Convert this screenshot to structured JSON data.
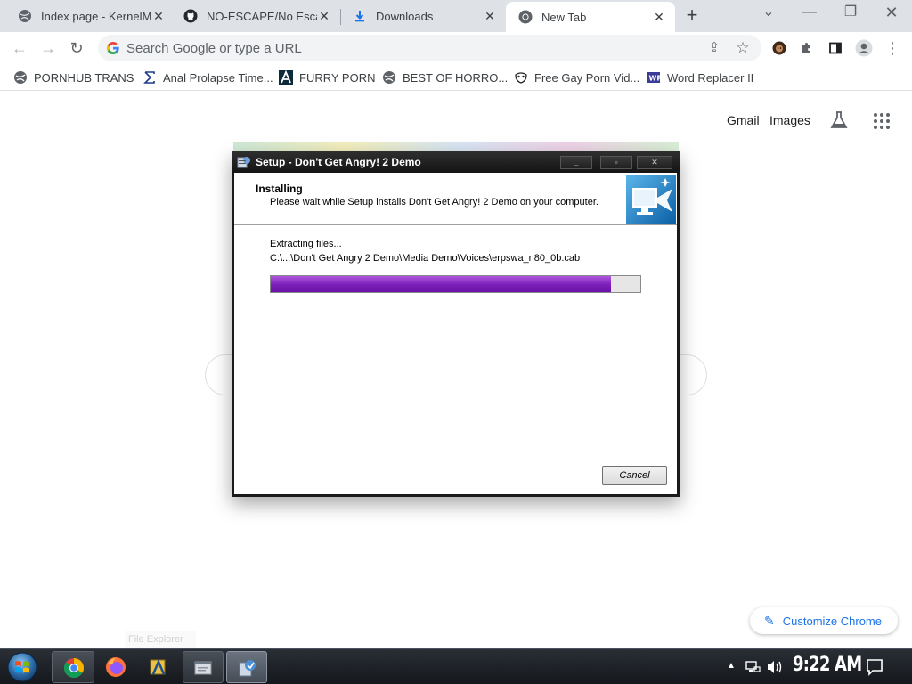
{
  "browser": {
    "tabs": [
      {
        "title": "Index page - KernelM",
        "favicon": "globe-icon",
        "active": false
      },
      {
        "title": "NO-ESCAPE/No Esca",
        "favicon": "github-icon",
        "active": false
      },
      {
        "title": "Downloads",
        "favicon": "download-icon",
        "active": false
      },
      {
        "title": "New Tab",
        "favicon": "chrome-icon",
        "active": true
      }
    ],
    "omnibox_placeholder": "Search Google or type a URL",
    "bookmarks": [
      {
        "label": "PORNHUB TRANS",
        "icon": "globe-icon"
      },
      {
        "label": "Anal Prolapse Time...",
        "icon": "sigma-icon"
      },
      {
        "label": "FURRY PORN",
        "icon": "a-logo-icon"
      },
      {
        "label": "BEST OF HORRO...",
        "icon": "globe-icon"
      },
      {
        "label": "Free Gay Porn Vid...",
        "icon": "mask-icon"
      },
      {
        "label": "Word Replacer II",
        "icon": "wr-icon"
      }
    ]
  },
  "ntp": {
    "gmail": "Gmail",
    "images": "Images",
    "customize": "Customize Chrome"
  },
  "installer": {
    "title": "Setup - Don't Get Angry! 2 Demo",
    "heading": "Installing",
    "subheading": "Please wait while Setup installs Don't Get Angry! 2 Demo on your computer.",
    "status": "Extracting files...",
    "path": "C:\\...\\Don't Get Angry 2 Demo\\Media Demo\\Voices\\erpswa_n80_0b.cab",
    "progress_percent": 92,
    "cancel": "Cancel",
    "progress_color": "#7b1fb8"
  },
  "taskbar": {
    "tooltip": "File Explorer",
    "clock": "9:22 AM",
    "apps": [
      "chrome-icon",
      "firefox-icon",
      "file-explorer-icon",
      "window-icon",
      "setup-icon"
    ]
  },
  "colors": {
    "tabstrip": "#dee1e6",
    "link_blue": "#1a73e8"
  }
}
